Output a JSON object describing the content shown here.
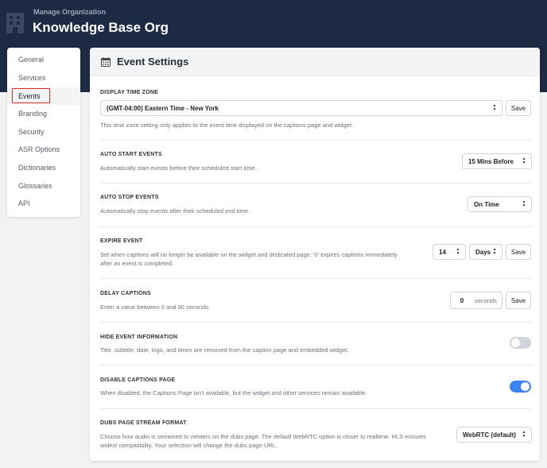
{
  "header": {
    "subtitle": "Manage Organization",
    "title": "Knowledge Base Org"
  },
  "sidebar": {
    "items": [
      {
        "label": "General"
      },
      {
        "label": "Services"
      },
      {
        "label": "Events"
      },
      {
        "label": "Branding"
      },
      {
        "label": "Security"
      },
      {
        "label": "ASR Options"
      },
      {
        "label": "Dictionaries"
      },
      {
        "label": "Glossaries"
      },
      {
        "label": "API"
      }
    ],
    "active": "Events"
  },
  "panel": {
    "title": "Event Settings",
    "icon": "calendar-icon"
  },
  "sections": {
    "timezone": {
      "title": "DISPLAY TIME ZONE",
      "value": "(GMT-04:00) Eastern Time - New York",
      "save": "Save",
      "desc": "This time zone setting only applies to the event time displayed on the captions page and widget."
    },
    "autostart": {
      "title": "AUTO START EVENTS",
      "desc": "Automatically start events before their scheduled start time.",
      "value": "15 Mins Before"
    },
    "autostop": {
      "title": "AUTO STOP EVENTS",
      "desc": "Automatically stop events after their scheduled end time.",
      "value": "On Time"
    },
    "expire": {
      "title": "EXPIRE EVENT",
      "desc1": "Set when captions will no longer be available on the widget and dedicated page. '0' expires captions immediately",
      "desc2": "after an event is completed.",
      "number": "14",
      "unit": "Days",
      "save": "Save"
    },
    "delay": {
      "title": "DELAY CAPTIONS",
      "desc": "Enter a value between 0 and 90 seconds.",
      "value": "0",
      "unit": "seconds",
      "save": "Save"
    },
    "hideinfo": {
      "title": "HIDE EVENT INFORMATION",
      "desc": "Title, subtitle, date, logo, and times are removed from the caption page and embedded widget.",
      "enabled": false
    },
    "disablecaptions": {
      "title": "DISABLE CAPTIONS PAGE",
      "desc": "When disabled, the Captions Page isn't available, but the widget and other services remain available.",
      "enabled": true
    },
    "dubs": {
      "title": "DUBS PAGE STREAM FORMAT",
      "desc1": "Choose how audio is streamed to viewers on the dubs page. The default WebRTC option is closer to realtime. HLS ensures",
      "desc2": "widest compatibility. Your selection will change the dubs page URL.",
      "value": "WebRTC (default)"
    }
  },
  "colors": {
    "header_bg": "#1c2a44",
    "toggle_on": "#3b82f6",
    "highlight": "#e0282d"
  }
}
